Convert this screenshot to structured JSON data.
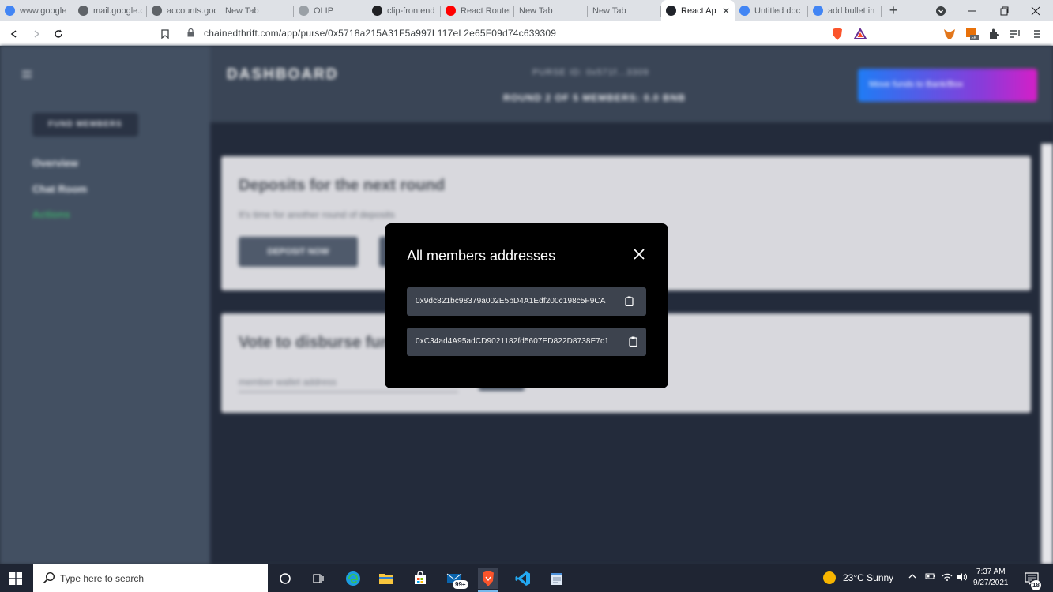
{
  "browser": {
    "tabs": [
      {
        "title": "www.google",
        "favicon": "google-icon",
        "color": "#4285f4",
        "active": false
      },
      {
        "title": "mail.google.c",
        "favicon": "globe-icon",
        "color": "#5f6368",
        "active": false
      },
      {
        "title": "accounts.goo",
        "favicon": "globe-icon",
        "color": "#5f6368",
        "active": false
      },
      {
        "title": "New Tab",
        "favicon": "",
        "color": "",
        "active": false
      },
      {
        "title": "OLIP",
        "favicon": "shield-icon",
        "color": "#9aa0a6",
        "active": false
      },
      {
        "title": "clip-frontend",
        "favicon": "github-icon",
        "color": "#202124",
        "active": false
      },
      {
        "title": "React Router",
        "favicon": "youtube-icon",
        "color": "#ff0000",
        "active": false
      },
      {
        "title": "New Tab",
        "favicon": "",
        "color": "",
        "active": false
      },
      {
        "title": "New Tab",
        "favicon": "",
        "color": "",
        "active": false
      },
      {
        "title": "React Ap",
        "favicon": "react-icon",
        "color": "#20232a",
        "active": true
      },
      {
        "title": "Untitled doc",
        "favicon": "docs-icon",
        "color": "#4285f4",
        "active": false
      },
      {
        "title": "add bullet in",
        "favicon": "google-icon",
        "color": "#4285f4",
        "active": false
      }
    ],
    "url": "chainedthrift.com/app/purse/0x5718a215A31F5a997L117eL2e65F09d74c639309"
  },
  "app": {
    "brand": "DASHBOARD",
    "purse_id": "PURSE ID: 0x571f...3309",
    "round_info": "ROUND 2 OF 5 MEMBERS: 0.0 BNB",
    "move_funds_button": "Move funds to Bank/Box",
    "fund_members_button": "FUND MEMBERS",
    "sidebar_links": [
      "Overview",
      "Chat Room",
      "Actions"
    ],
    "deposit_card": {
      "title": "Deposits for the next round",
      "subtitle": "It's time for another round of deposits",
      "button": "DEPOSIT NOW"
    },
    "vote_card": {
      "title": "Vote to disburse funds",
      "input_placeholder": "member wallet address"
    }
  },
  "modal": {
    "title": "All members addresses",
    "addresses": [
      "0x9dc821bc98379a002E5bD4A1Edf200c198c5F9CA",
      "0xC34ad4A95adCD9021182fd5607ED822D8738E7c1"
    ]
  },
  "taskbar": {
    "search_placeholder": "Type here to search",
    "badge_count": "99+",
    "weather": "23°C  Sunny",
    "time": "7:37 AM",
    "date": "9/27/2021",
    "notification_count": "18"
  },
  "colors": {
    "modal_bg": "#000000",
    "address_row_bg": "#3d434e",
    "app_bg": "#3a4556",
    "taskbar_bg": "#1f2533"
  }
}
